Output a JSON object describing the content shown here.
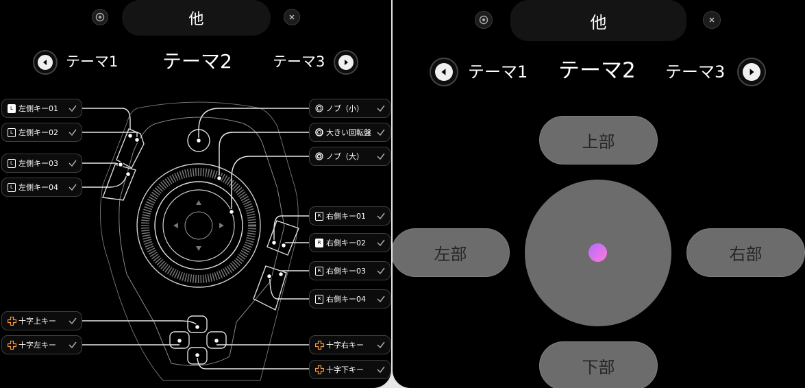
{
  "left": {
    "title": "他",
    "prev_theme": "テーマ1",
    "current_theme": "テーマ2",
    "next_theme": "テーマ3",
    "left_labels": [
      "左側キー01",
      "左側キー02",
      "左側キー03",
      "左側キー04"
    ],
    "right_top_labels": [
      "ノブ（小）",
      "大きい回転盤",
      "ノブ（大）"
    ],
    "right_labels": [
      "右側キー01",
      "右側キー02",
      "右側キー03",
      "右側キー04"
    ],
    "cross_left_labels": [
      "十字上キー",
      "十字左キー"
    ],
    "cross_right_labels": [
      "十字右キー",
      "十字下キー"
    ],
    "side_icon_left": "L",
    "side_icon_right": "R"
  },
  "right": {
    "title": "他",
    "prev_theme": "テーマ1",
    "current_theme": "テーマ2",
    "next_theme": "テーマ3",
    "dpad": {
      "up": "上部",
      "left": "左部",
      "right": "右部",
      "down": "下部"
    }
  },
  "icons": {
    "settings": "target-icon",
    "close": "close-icon",
    "prev": "triangle-left-icon",
    "next": "triangle-right-icon",
    "check": "check-icon",
    "cross": "dpad-icon"
  },
  "colors": {
    "background": "#000000",
    "accent_start": "#b36cff",
    "accent_end": "#ff7ad9",
    "pill": "#6c6c6c"
  }
}
